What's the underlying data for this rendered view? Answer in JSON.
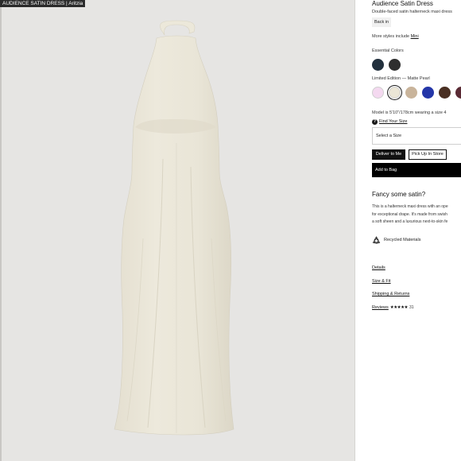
{
  "window": {
    "tab_title": "AUDIENCE SATIN DRESS | Aritzia"
  },
  "product": {
    "title": "Audience Satin Dress",
    "subtitle": "Double-faced satin halterneck maxi dress",
    "stock_badge": "Back in",
    "more_styles_prefix": "More styles include ",
    "more_styles_link": "Mini"
  },
  "colors": {
    "essential_label": "Essential Colors",
    "essential": [
      {
        "name": "navy",
        "hex": "#22303d"
      },
      {
        "name": "charcoal",
        "hex": "#2e2e2e"
      }
    ],
    "limited_label": "Limited Edition — Matte Pearl",
    "limited": [
      {
        "name": "pink",
        "hex": "#f4d9f0"
      },
      {
        "name": "matte-pearl",
        "hex": "#ebe6d6"
      },
      {
        "name": "taupe",
        "hex": "#c9b49b"
      },
      {
        "name": "blue",
        "hex": "#2436a8"
      },
      {
        "name": "brown",
        "hex": "#4a3023"
      },
      {
        "name": "plum",
        "hex": "#5a2a34"
      }
    ],
    "selected_limited_index": 1
  },
  "sizing": {
    "model_note": "Model is 5'10\"/178cm wearing a size 4",
    "find_size_link": "Find Your Size",
    "select_placeholder": "Select a Size"
  },
  "delivery": {
    "deliver_label": "Deliver to Me",
    "pickup_label": "Pick Up In Store"
  },
  "cart": {
    "add_label": "Add to Bag"
  },
  "about": {
    "heading": "Fancy some satin?",
    "lines": [
      "This is a halterneck maxi dress with an ope",
      "for exceptional drape. It's made from swish",
      "a soft sheen and a luxurious next-to-skin fe"
    ]
  },
  "features": {
    "recycled_label": "Recycled Materials"
  },
  "links": {
    "details": "Details",
    "size_fit": "Size & Fit",
    "shipping": "Shipping & Returns",
    "reviews": "Reviews",
    "stars": "★★★★★",
    "review_count": "31",
    "rating": 4.5
  },
  "accent_colors": {
    "dress": "#ebe7da",
    "background": "#e6e5e3"
  }
}
